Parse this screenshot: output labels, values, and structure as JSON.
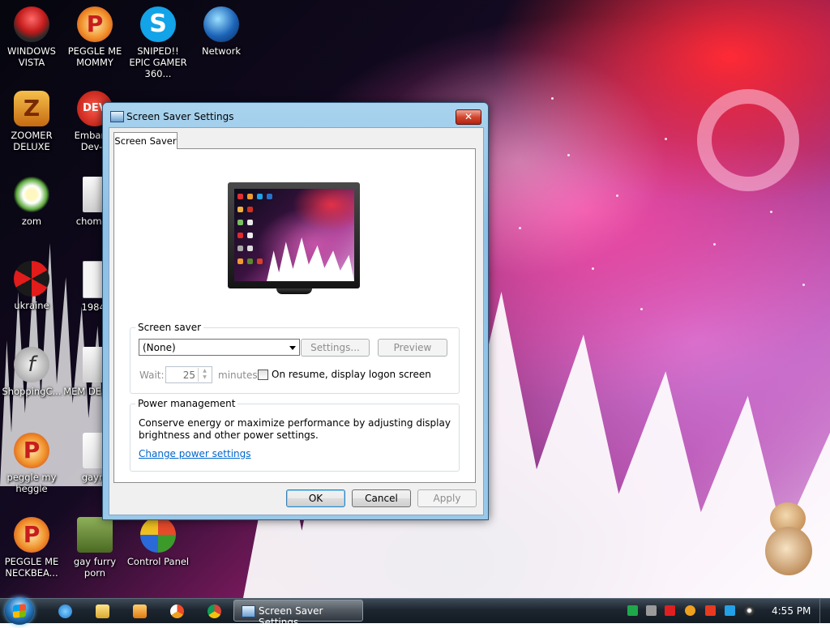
{
  "desktop": {
    "icons": [
      {
        "label": "WINDOWS VISTA",
        "icon": "windows-vista-icon"
      },
      {
        "label": "PEGGLE ME MOMMY",
        "icon": "peggle-icon"
      },
      {
        "label": "SNIPED!! EPIC GAMER 360...",
        "icon": "skype-icon"
      },
      {
        "label": "Network",
        "icon": "network-icon"
      },
      {
        "label": "ZOOMER DELUXE",
        "icon": "zoomer-icon"
      },
      {
        "label": "Embarca Dev-C",
        "icon": "dev-cpp-icon"
      },
      {
        "label": "zom",
        "icon": "flower-icon"
      },
      {
        "label": "chomikr",
        "icon": "clock-file-icon"
      },
      {
        "label": "ukraine",
        "icon": "radiation-icon"
      },
      {
        "label": "1984.",
        "icon": "text-file-icon"
      },
      {
        "label": "ShoppingC...",
        "icon": "flash-icon"
      },
      {
        "label": "MEM DESTRU",
        "icon": "clock-file-icon"
      },
      {
        "label": "peggle my heggle",
        "icon": "peggle-icon"
      },
      {
        "label": "gaym",
        "icon": "media-icon"
      },
      {
        "label": "PEGGLE ME NECKBEA...",
        "icon": "peggle-icon"
      },
      {
        "label": "gay furry porn",
        "icon": "box-icon"
      },
      {
        "label": "Control Panel",
        "icon": "control-panel-icon"
      }
    ]
  },
  "dialog": {
    "title": "Screen Saver Settings",
    "close_glyph": "✕",
    "tab_label": "Screen Saver",
    "screen_saver_group": {
      "legend": "Screen saver",
      "selected": "(None)",
      "settings_button": "Settings...",
      "preview_button": "Preview",
      "wait_label": "Wait:",
      "wait_value": "25",
      "minutes_label": "minutes",
      "resume_checkbox_label": "On resume, display logon screen",
      "resume_checked": false
    },
    "power_group": {
      "legend": "Power management",
      "description": "Conserve energy or maximize performance by adjusting display brightness and other power settings.",
      "link": "Change power settings"
    },
    "buttons": {
      "ok": "OK",
      "cancel": "Cancel",
      "apply": "Apply"
    }
  },
  "taskbar": {
    "active_window": "Screen Saver Settings",
    "clock": "4:55 PM",
    "pinned": [
      "ie-icon",
      "explorer-icon",
      "media-player-icon",
      "paint-icon",
      "chrome-icon"
    ]
  },
  "colors": {
    "link": "#0066cc",
    "close_button": "#d2462f",
    "taskbar": "#1d2630"
  }
}
